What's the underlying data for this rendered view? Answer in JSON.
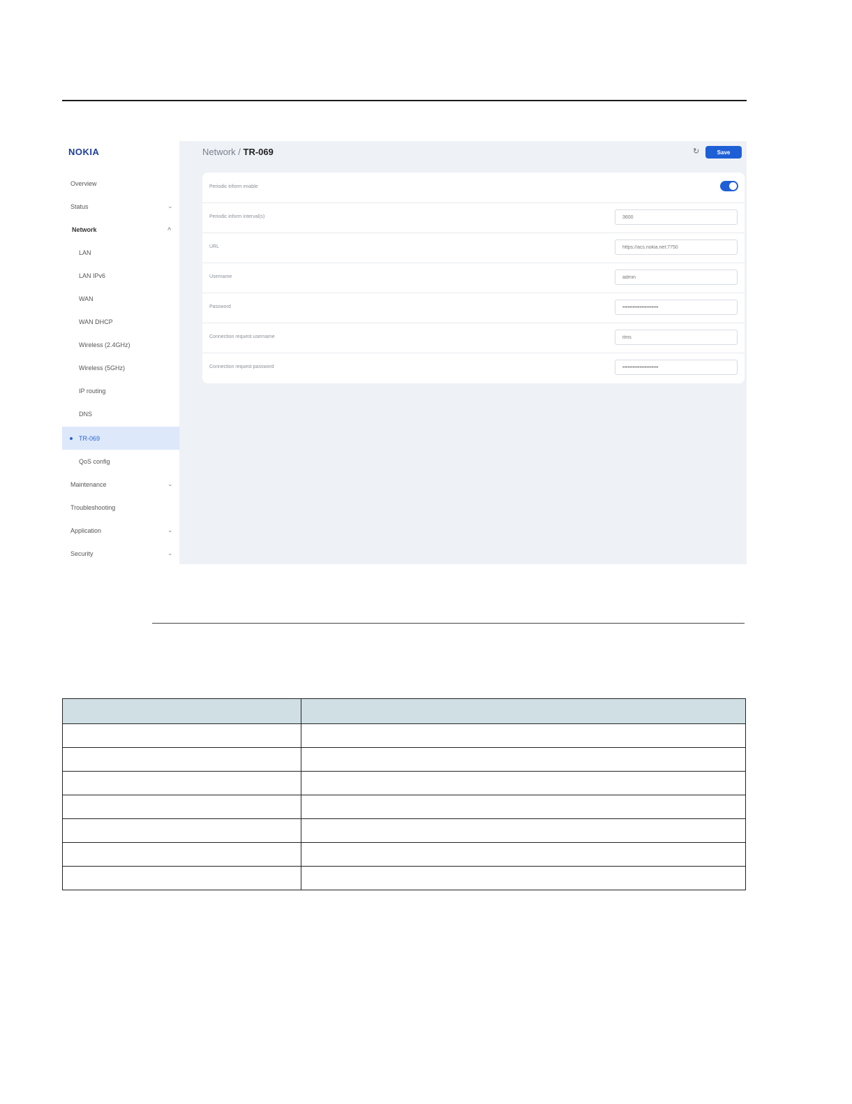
{
  "logo": "NOKIA",
  "sidebar": {
    "items": [
      {
        "label": "Overview",
        "chevron": ""
      },
      {
        "label": "Status",
        "chevron": "⌄"
      },
      {
        "label": "Network",
        "chevron": "^"
      },
      {
        "label": "LAN",
        "chevron": ""
      },
      {
        "label": "LAN IPv6",
        "chevron": ""
      },
      {
        "label": "WAN",
        "chevron": ""
      },
      {
        "label": "WAN DHCP",
        "chevron": ""
      },
      {
        "label": "Wireless (2.4GHz)",
        "chevron": ""
      },
      {
        "label": "Wireless (5GHz)",
        "chevron": ""
      },
      {
        "label": "IP routing",
        "chevron": ""
      },
      {
        "label": "DNS",
        "chevron": ""
      },
      {
        "label": "TR-069",
        "chevron": "",
        "active": true
      },
      {
        "label": "QoS config",
        "chevron": ""
      },
      {
        "label": "Maintenance",
        "chevron": "⌄"
      },
      {
        "label": "Troubleshooting",
        "chevron": ""
      },
      {
        "label": "Application",
        "chevron": "⌄"
      },
      {
        "label": "Security",
        "chevron": "⌄"
      }
    ]
  },
  "header": {
    "breadcrumb_parent": "Network / ",
    "breadcrumb_current": "TR-069",
    "refresh_icon": "refresh-icon",
    "save_label": "Save"
  },
  "form": {
    "periodic_enable_label": "Periodic inform enable",
    "periodic_enable_on": true,
    "fields": [
      {
        "label": "Periodic inform interval(s)",
        "value": "3600"
      },
      {
        "label": "URL",
        "value": "https://acs.nokia.net:7750"
      },
      {
        "label": "Username",
        "value": "admin"
      },
      {
        "label": "Password",
        "value": "•••••••••••••••••••••"
      },
      {
        "label": "Connection request username",
        "value": "itms"
      },
      {
        "label": "Connection request password",
        "value": "•••••••••••••••••••••"
      }
    ]
  },
  "colors": {
    "accent": "#1f5fd6",
    "sidebar_active_bg": "#dde8fa",
    "main_bg": "#eef1f6",
    "table_header_bg": "#cfdfe4"
  }
}
